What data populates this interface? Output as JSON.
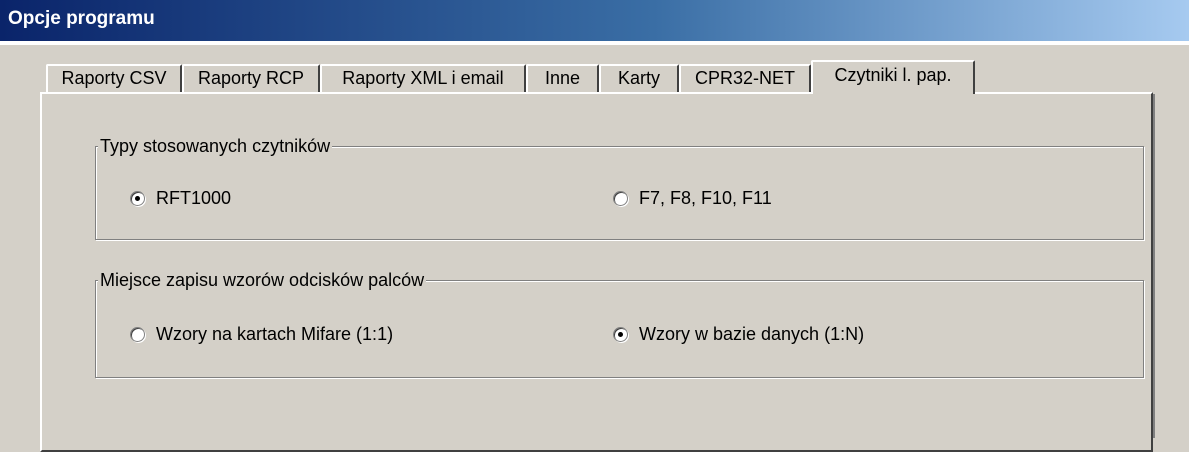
{
  "window": {
    "title": "Opcje programu"
  },
  "tabs": [
    {
      "label": "Raporty CSV",
      "active": false
    },
    {
      "label": "Raporty RCP",
      "active": false
    },
    {
      "label": "Raporty XML i email",
      "active": false
    },
    {
      "label": "Inne",
      "active": false
    },
    {
      "label": "Karty",
      "active": false
    },
    {
      "label": "CPR32-NET",
      "active": false
    },
    {
      "label": "Czytniki l. pap.",
      "active": true
    }
  ],
  "groups": {
    "reader_types": {
      "legend": "Typy stosowanych czytników",
      "options": [
        {
          "label": "RFT1000",
          "selected": true
        },
        {
          "label": "F7, F8, F10, F11",
          "selected": false
        }
      ]
    },
    "fingerprint_storage": {
      "legend": "Miejsce zapisu wzorów odcisków palców",
      "options": [
        {
          "label": "Wzory na kartach Mifare (1:1)",
          "selected": false
        },
        {
          "label": "Wzory w bazie danych (1:N)",
          "selected": true
        }
      ]
    }
  }
}
